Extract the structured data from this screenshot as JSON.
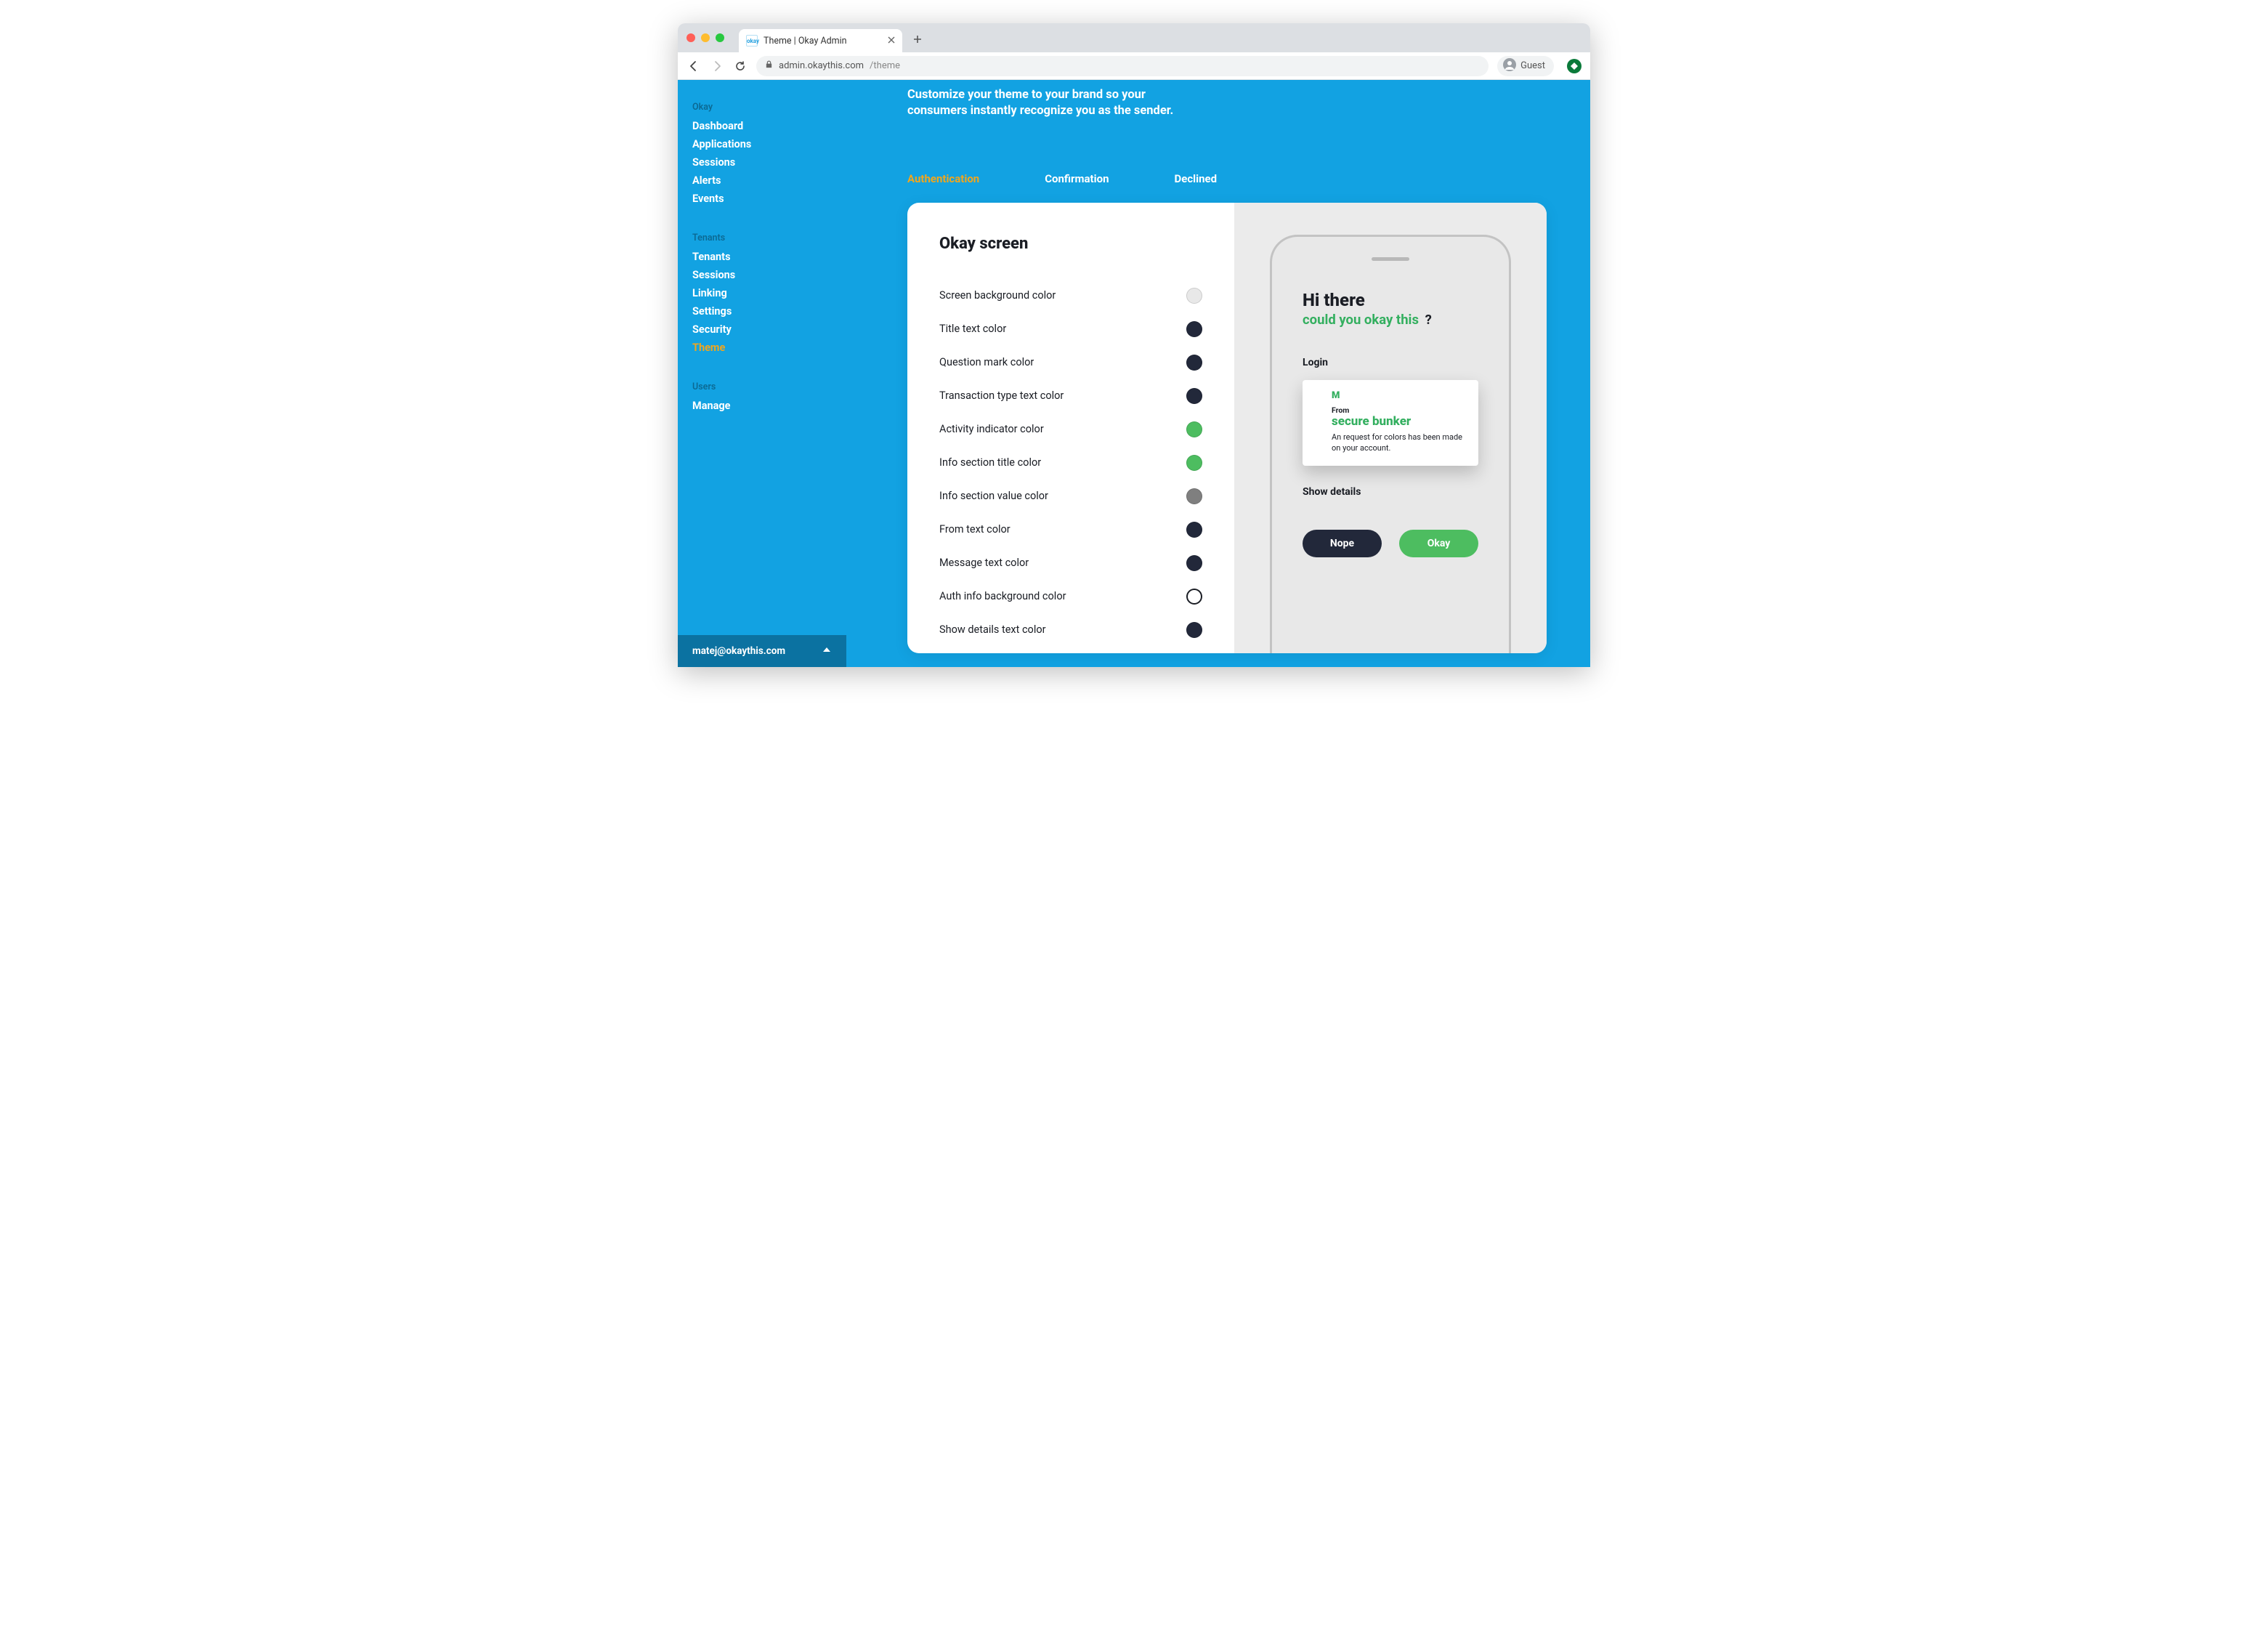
{
  "chrome": {
    "tab_title": "Theme | Okay Admin",
    "favicon_text": "okay",
    "url_host": "admin.okaythis.com",
    "url_path": "/theme",
    "profile_label": "Guest"
  },
  "sidebar": {
    "groups": [
      {
        "label": "Okay",
        "items": [
          "Dashboard",
          "Applications",
          "Sessions",
          "Alerts",
          "Events"
        ]
      },
      {
        "label": "Tenants",
        "items": [
          "Tenants",
          "Sessions",
          "Linking",
          "Settings",
          "Security",
          "Theme"
        ]
      },
      {
        "label": "Users",
        "items": [
          "Manage"
        ]
      }
    ],
    "active_item": "Theme",
    "footer_email": "matej@okaythis.com"
  },
  "main": {
    "hero": "Customize your theme to your brand so your consumers instantly recognize you as the sender.",
    "tabs": [
      "Authentication",
      "Confirmation",
      "Declined"
    ],
    "active_tab": "Authentication",
    "panel_title": "Okay screen",
    "settings": [
      {
        "label": "Screen background color",
        "value": "#e8e8e8"
      },
      {
        "label": "Title text color",
        "value": "#22283a"
      },
      {
        "label": "Question mark color",
        "value": "#22283a"
      },
      {
        "label": "Transaction type text color",
        "value": "#22283a"
      },
      {
        "label": "Activity indicator color",
        "value": "#4dbd60"
      },
      {
        "label": "Info section title color",
        "value": "#4dbd60"
      },
      {
        "label": "Info section value color",
        "value": "#7f7f7f"
      },
      {
        "label": "From text color",
        "value": "#22283a"
      },
      {
        "label": "Message text color",
        "value": "#22283a"
      },
      {
        "label": "Auth info background color",
        "value": "#ffffff",
        "outline": true
      },
      {
        "label": "Show details text color",
        "value": "#22283a"
      }
    ]
  },
  "mock": {
    "title": "Hi there",
    "subtitle": "could you okay this",
    "qmark": "?",
    "transaction_type": "Login",
    "info_logo": "M",
    "info_from_label": "From",
    "info_from_value": "secure bunker",
    "info_message": "An request for colors has been made on your account.",
    "show_details": "Show details",
    "btn_decline": "Nope",
    "btn_confirm": "Okay"
  }
}
